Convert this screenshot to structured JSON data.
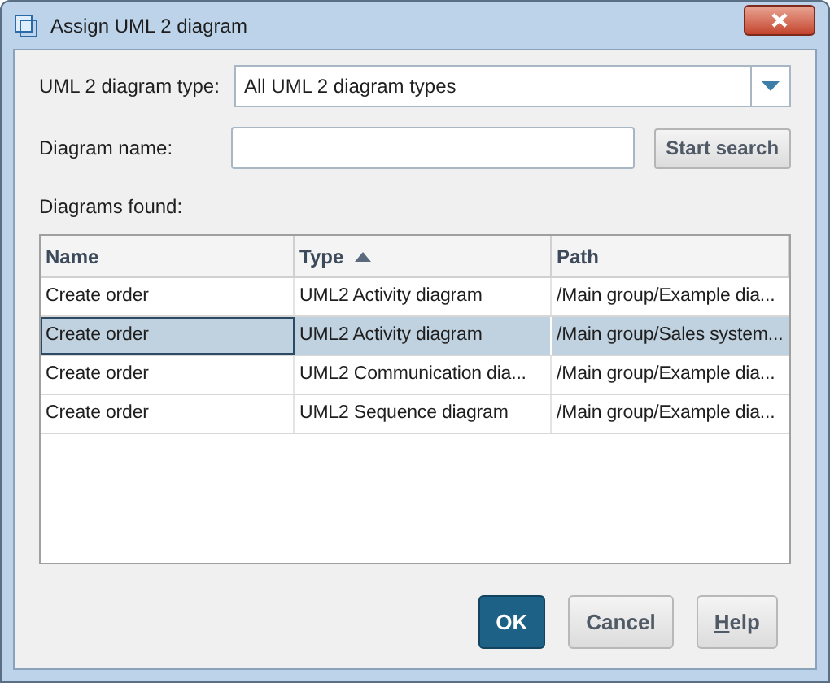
{
  "window": {
    "title": "Assign UML 2 diagram"
  },
  "type_field": {
    "label": "UML 2 diagram type:",
    "value": "All UML 2 diagram types"
  },
  "name_field": {
    "label": "Diagram name:"
  },
  "search_button": "Start search",
  "results_label": "Diagrams found:",
  "table": {
    "columns": [
      {
        "label": "Name",
        "sorted": false
      },
      {
        "label": "Type",
        "sorted": true
      },
      {
        "label": "Path",
        "sorted": false
      }
    ],
    "rows": [
      {
        "cells": [
          "Create order",
          "UML2 Activity diagram",
          "/Main group/Example dia..."
        ],
        "selected": false
      },
      {
        "cells": [
          "Create order",
          "UML2 Activity diagram",
          "/Main group/Sales system..."
        ],
        "selected": true
      },
      {
        "cells": [
          "Create order",
          "UML2 Communication dia...",
          "/Main group/Example dia..."
        ],
        "selected": false
      },
      {
        "cells": [
          "Create order",
          "UML2 Sequence diagram",
          "/Main group/Example dia..."
        ],
        "selected": false
      }
    ]
  },
  "buttons": [
    {
      "label": "OK",
      "kind": "primary",
      "mnemonic": false
    },
    {
      "label": "Cancel",
      "kind": "normal",
      "mnemonic": false
    },
    {
      "label": "Help",
      "kind": "normal",
      "mnemonic": true
    }
  ]
}
